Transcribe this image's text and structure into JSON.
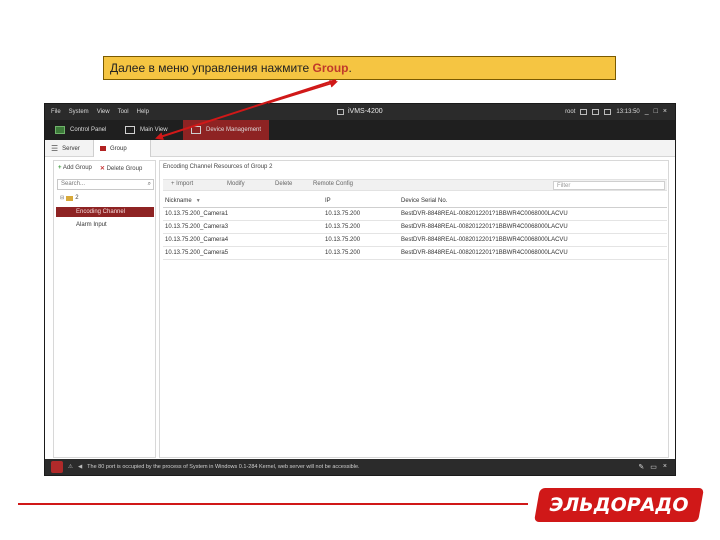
{
  "instruction": {
    "text_before": "Далее в меню управления нажмите ",
    "highlight": "Group",
    "text_after": "."
  },
  "app": {
    "menu": [
      "File",
      "System",
      "View",
      "Tool",
      "Help"
    ],
    "title": "iVMS-4200",
    "user": "root",
    "time": "13:13:50",
    "window_buttons": [
      "_",
      "□",
      "×"
    ]
  },
  "main_tabs": [
    {
      "label": "Control Panel",
      "icon": "control-panel-icon"
    },
    {
      "label": "Main View",
      "icon": "main-view-icon"
    },
    {
      "label": "Device Management",
      "icon": "device-management-icon",
      "active": true
    }
  ],
  "sub_tabs": [
    {
      "label": "Server"
    },
    {
      "label": "Group",
      "active": true
    }
  ],
  "left": {
    "add_group": "Add Group",
    "delete_group": "Delete Group",
    "search_placeholder": "Search...",
    "root_label": "2",
    "items": [
      {
        "label": "Encoding Channel",
        "selected": true
      },
      {
        "label": "Alarm Input",
        "selected": false
      }
    ]
  },
  "right": {
    "title": "Encoding Channel Resources of Group 2",
    "toolbar": [
      "Import",
      "Modify",
      "Delete",
      "Remote Config"
    ],
    "filter_placeholder": "Filter",
    "columns": [
      "Nickname",
      "IP",
      "Device Serial No."
    ],
    "rows": [
      [
        "10.13.75.200_Camera1",
        "10.13.75.200",
        "BestDVR-8848REAL-0082012201?1BBWR4C0068000LACVU"
      ],
      [
        "10.13.75.200_Camera3",
        "10.13.75.200",
        "BestDVR-8848REAL-0082012201?1BBWR4C0068000LACVU"
      ],
      [
        "10.13.75.200_Camera4",
        "10.13.75.200",
        "BestDVR-8848REAL-0082012201?1BBWR4C0068000LACVU"
      ],
      [
        "10.13.75.200_Camera5",
        "10.13.75.200",
        "BestDVR-8848REAL-0082012201?1BBWR4C0068000LACVU"
      ]
    ]
  },
  "statusbar": {
    "message": "The 80 port is occupied by the process of System in Windows 0.1-284 Kernel, web server will not be accessible.",
    "right_icons": [
      "pin-icon",
      "restore-icon",
      "close-icon"
    ]
  },
  "footer": {
    "logo_text": "ЭЛЬДОРАДО"
  },
  "colors": {
    "accent": "#8e2323",
    "callout_bg": "#f5c542",
    "arrow": "#d01818",
    "brand_red": "#d01818"
  }
}
